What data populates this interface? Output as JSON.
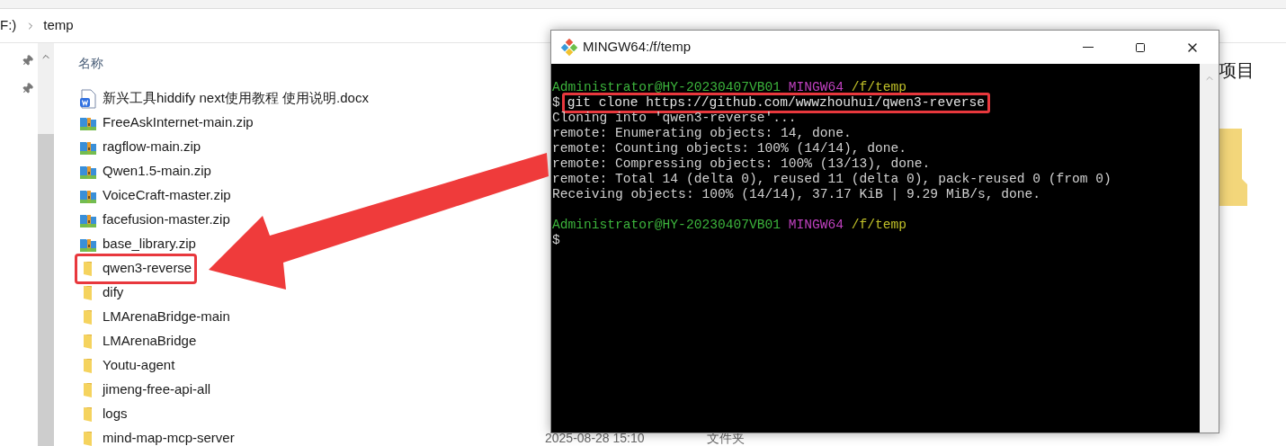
{
  "explorer": {
    "breadcrumb": [
      "F:)",
      "temp"
    ],
    "column_header": "名称",
    "files": [
      {
        "name": "新兴工具hiddify next使用教程 使用说明.docx",
        "kind": "docx",
        "highlighted": false
      },
      {
        "name": "FreeAskInternet-main.zip",
        "kind": "zip",
        "highlighted": false
      },
      {
        "name": "ragflow-main.zip",
        "kind": "zip",
        "highlighted": false
      },
      {
        "name": "Qwen1.5-main.zip",
        "kind": "zip",
        "highlighted": false
      },
      {
        "name": "VoiceCraft-master.zip",
        "kind": "zip",
        "highlighted": false
      },
      {
        "name": "facefusion-master.zip",
        "kind": "zip",
        "highlighted": false
      },
      {
        "name": "base_library.zip",
        "kind": "zip",
        "highlighted": false
      },
      {
        "name": "qwen3-reverse",
        "kind": "folder",
        "highlighted": true
      },
      {
        "name": "dify",
        "kind": "folder",
        "highlighted": false
      },
      {
        "name": "LMArenaBridge-main",
        "kind": "folder",
        "highlighted": false
      },
      {
        "name": "LMArenaBridge",
        "kind": "folder",
        "highlighted": false
      },
      {
        "name": "Youtu-agent",
        "kind": "folder",
        "highlighted": false
      },
      {
        "name": "jimeng-free-api-all",
        "kind": "folder",
        "highlighted": false
      },
      {
        "name": "logs",
        "kind": "folder",
        "highlighted": false
      },
      {
        "name": "mind-map-mcp-server",
        "kind": "folder",
        "highlighted": false,
        "date": "2025-08-28 15:10",
        "type": "文件夹"
      }
    ],
    "details_pane": {
      "label": "项目"
    }
  },
  "terminal": {
    "title": "MINGW64:/f/temp",
    "lines": [
      {
        "kind": "prompt",
        "user": "Administrator@HY-20230407VB01",
        "shell": "MINGW64",
        "path": "/f/temp"
      },
      {
        "kind": "command",
        "symbol": "$",
        "text": "git clone https://github.com/wwwzhouhui/qwen3-reverse",
        "highlighted": true
      },
      {
        "kind": "output",
        "text": "Cloning into 'qwen3-reverse'..."
      },
      {
        "kind": "output",
        "text": "remote: Enumerating objects: 14, done."
      },
      {
        "kind": "output",
        "text": "remote: Counting objects: 100% (14/14), done."
      },
      {
        "kind": "output",
        "text": "remote: Compressing objects: 100% (13/13), done."
      },
      {
        "kind": "output",
        "text": "remote: Total 14 (delta 0), reused 11 (delta 0), pack-reused 0 (from 0)"
      },
      {
        "kind": "output",
        "text": "Receiving objects: 100% (14/14), 37.17 KiB | 9.29 MiB/s, done."
      },
      {
        "kind": "blank"
      },
      {
        "kind": "prompt",
        "user": "Administrator@HY-20230407VB01",
        "shell": "MINGW64",
        "path": "/f/temp"
      },
      {
        "kind": "symbol",
        "text": "$"
      }
    ]
  }
}
